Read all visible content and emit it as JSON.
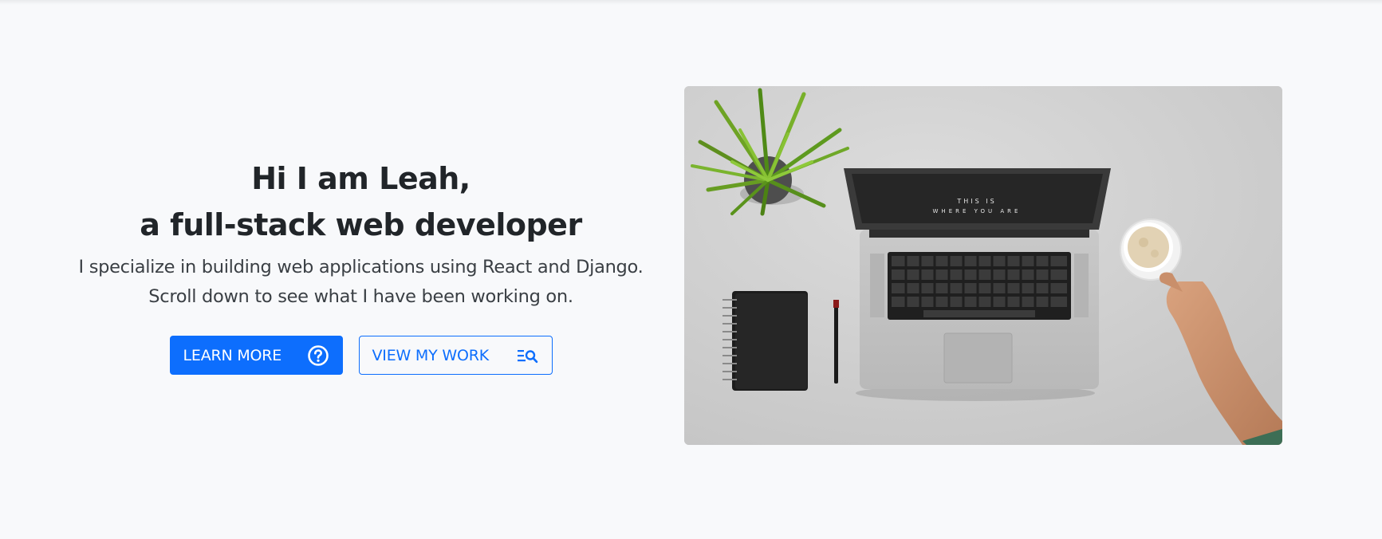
{
  "hero": {
    "title_line1": "Hi I am Leah,",
    "title_line2": "a full-stack web developer",
    "description": "I specialize in building web applications using React and Django. Scroll down to see what I have been working on.",
    "learn_more_label": "LEARN MORE",
    "learn_more_icon": "question-circle-icon",
    "view_work_label": "VIEW MY WORK",
    "view_work_icon": "search-list-icon",
    "image_alt": "Desk with laptop, plant, notebook, pen and coffee cup",
    "laptop_screen_text_1": "THIS IS",
    "laptop_screen_text_2": "WHERE YOU ARE"
  },
  "colors": {
    "primary": "#0d6efd",
    "background": "#f8f9fb",
    "text": "#212529"
  }
}
